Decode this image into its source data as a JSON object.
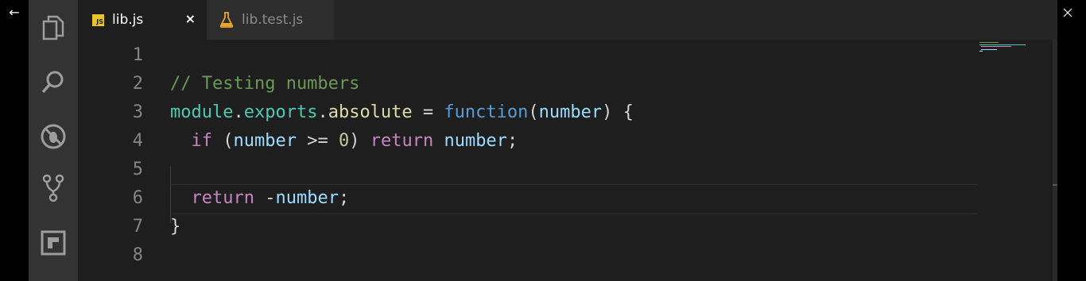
{
  "window": {
    "back_glyph": "←",
    "minimize_glyph": "—",
    "restore_glyph": "❐",
    "close_glyph": "✕"
  },
  "tabs": [
    {
      "label": "lib.js",
      "badge": "JS",
      "active": true,
      "close_glyph": "×"
    },
    {
      "label": "lib.test.js",
      "active": false
    }
  ],
  "activity_bar": [
    {
      "name": "explorer-icon"
    },
    {
      "name": "search-icon"
    },
    {
      "name": "debug-icon"
    },
    {
      "name": "source-control-icon"
    },
    {
      "name": "extensions-icon"
    }
  ],
  "editor": {
    "lines": [
      {
        "n": "1"
      },
      {
        "n": "2",
        "t": [
          "// Testing numbers"
        ]
      },
      {
        "n": "3",
        "t": [
          "module",
          ".",
          "exports",
          ".",
          "absolute",
          " = ",
          "function",
          "(",
          "number",
          ") {"
        ]
      },
      {
        "n": "4",
        "t": [
          "  ",
          "if",
          " (",
          "number",
          " >= ",
          "0",
          ") ",
          "return",
          " ",
          "number",
          ";"
        ]
      },
      {
        "n": "5"
      },
      {
        "n": "6",
        "t": [
          "  ",
          "return",
          " -",
          "number",
          ";"
        ]
      },
      {
        "n": "7",
        "t": [
          "}"
        ]
      },
      {
        "n": "8"
      }
    ]
  },
  "colors": {
    "background": "#1e1e1e",
    "comment": "#6a9955",
    "keyword": "#569cd6",
    "control": "#c586c0",
    "variable": "#9cdcfe",
    "module": "#4ec9b0",
    "function": "#dcdcaa"
  }
}
